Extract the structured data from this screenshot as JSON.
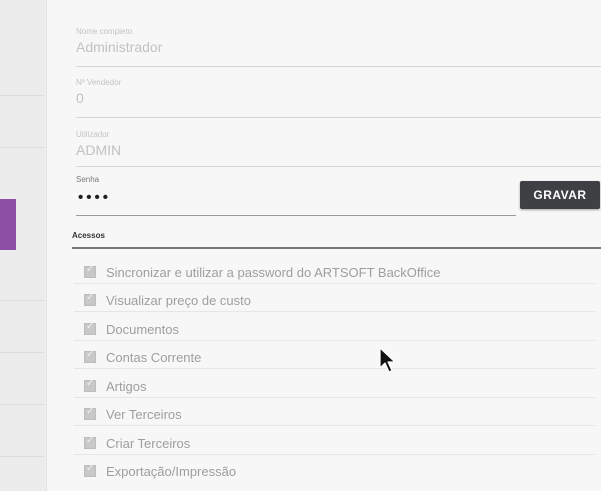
{
  "brand_color": "#8e4fa6",
  "form": {
    "name_field": {
      "label": "Nome completo",
      "value": "Administrador"
    },
    "number_field": {
      "label": "Nº Vendedor",
      "value": "0"
    },
    "login_field": {
      "label": "Utilizador",
      "value": "ADMIN"
    },
    "password_field": {
      "label": "Senha",
      "value": "••••"
    }
  },
  "save_button": {
    "label": "GRAVAR"
  },
  "access": {
    "title": "Acessos",
    "items": [
      {
        "label": "Sincronizar e utilizar a password do ARTSOFT BackOffice",
        "checked": true
      },
      {
        "label": "Visualizar preço de custo",
        "checked": true
      },
      {
        "label": "Documentos",
        "checked": true
      },
      {
        "label": "Contas Corrente",
        "checked": true
      },
      {
        "label": "Artigos",
        "checked": true
      },
      {
        "label": "Ver Terceiros",
        "checked": true
      },
      {
        "label": "Criar Terceiros",
        "checked": true
      },
      {
        "label": "Exportação/Impressão",
        "checked": true
      }
    ]
  },
  "icons": {
    "checkbox": "checkbox-checked-icon",
    "cursor": "mouse-pointer-icon"
  }
}
